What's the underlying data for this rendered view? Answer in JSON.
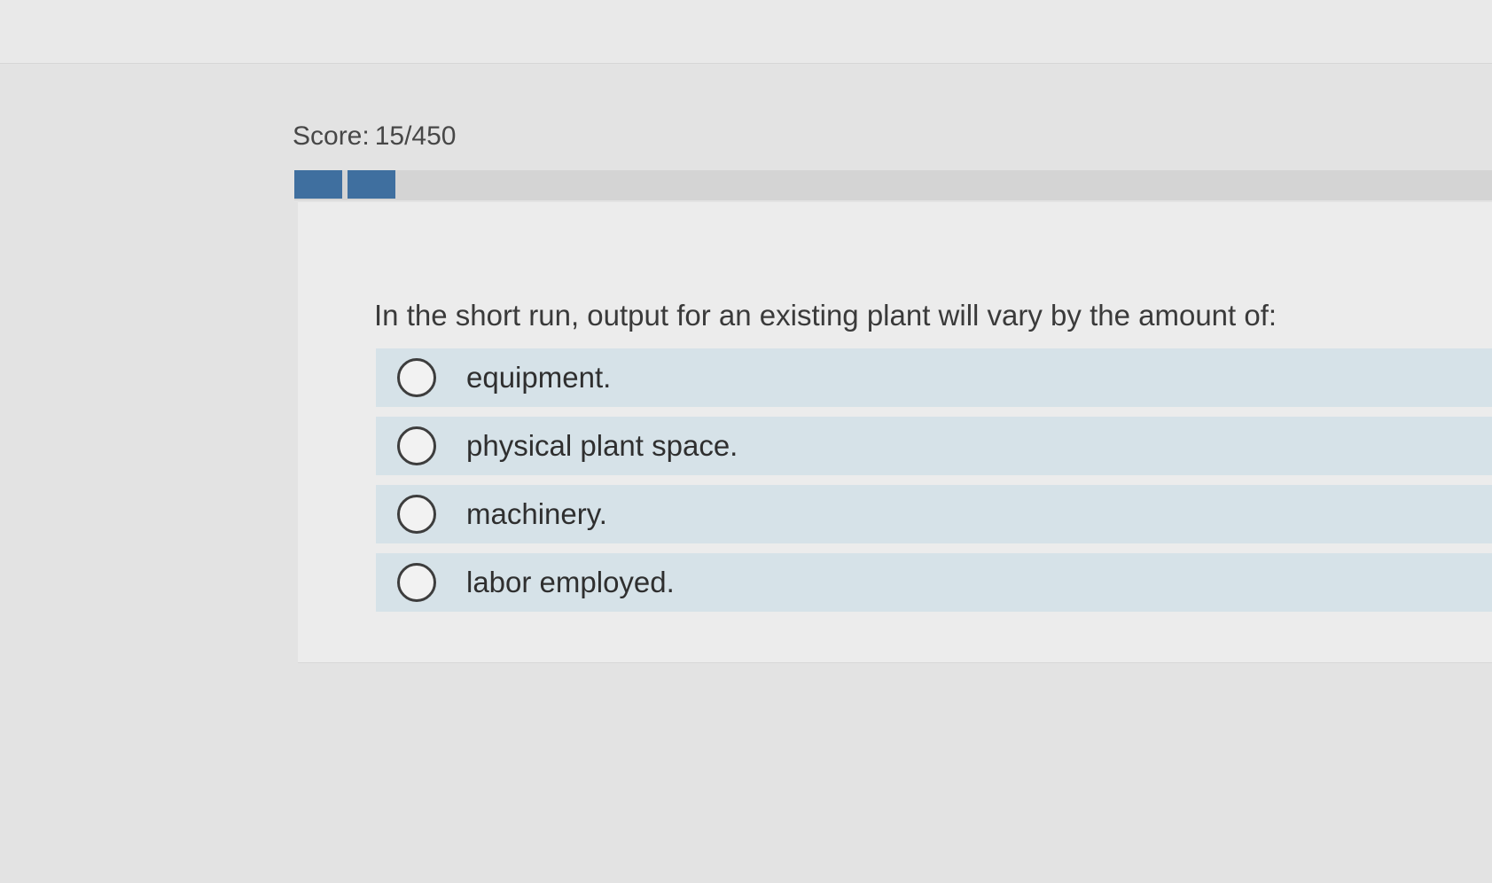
{
  "score": {
    "label": "Score:",
    "value": "15/450"
  },
  "progress": {
    "completed_segments": 2
  },
  "question": {
    "text": "In the short run, output for an existing plant will vary by the amount of:",
    "options": [
      {
        "label": "equipment."
      },
      {
        "label": "physical plant space."
      },
      {
        "label": "machinery."
      },
      {
        "label": "labor employed."
      }
    ]
  },
  "colors": {
    "progress_fill": "#3f6f9f",
    "option_bg": "#d6e2e8",
    "background": "#e3e3e3"
  },
  "icons": {
    "option_marker": "radio-circle-icon"
  }
}
